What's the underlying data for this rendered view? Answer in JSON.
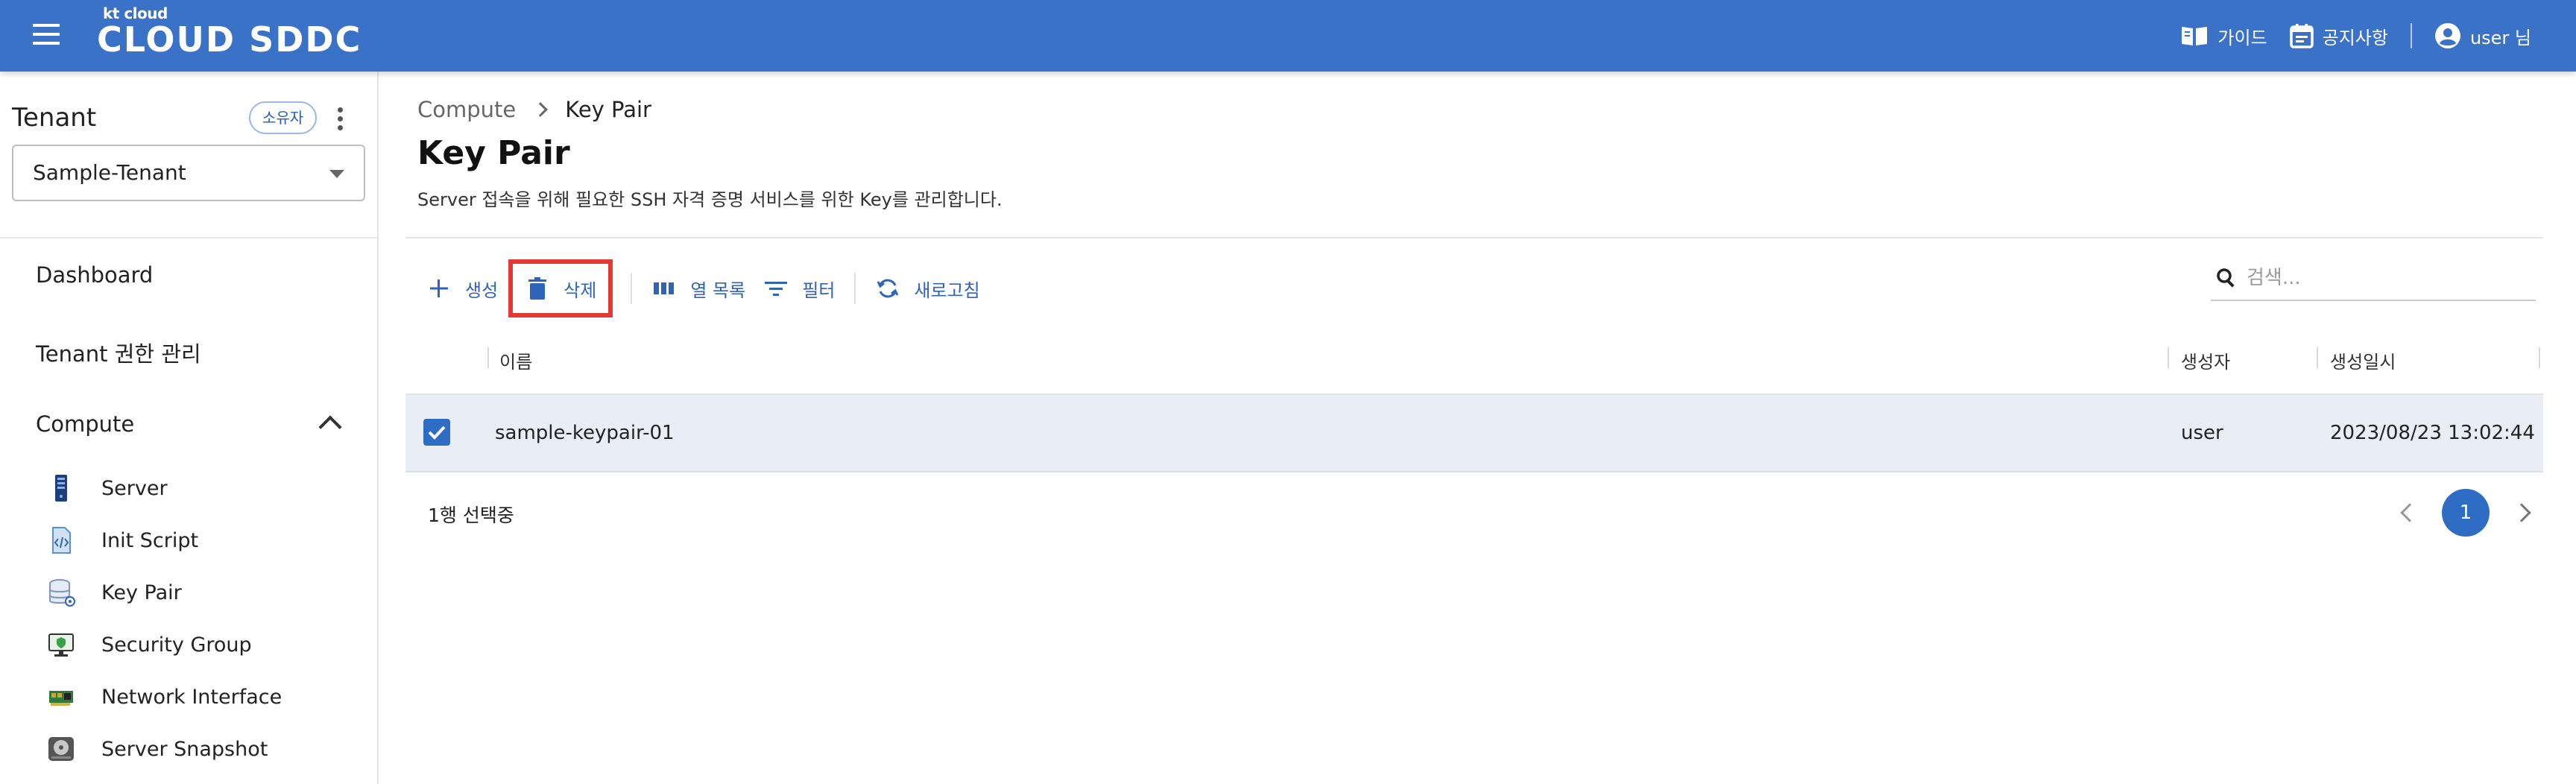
{
  "header": {
    "brand_small": "kt cloud",
    "brand_big": "CLOUD SDDC",
    "guide_label": "가이드",
    "notice_label": "공지사항",
    "user_label": "user 님",
    "bar_color": "#3a72c8"
  },
  "sidebar": {
    "tenant_title": "Tenant",
    "owner_badge": "소유자",
    "tenant_selected": "Sample-Tenant",
    "nav": {
      "dashboard": "Dashboard",
      "tenant_perm": "Tenant 권한 관리",
      "compute": "Compute"
    },
    "compute_items": [
      {
        "label": "Server",
        "icon": "server-icon"
      },
      {
        "label": "Init Script",
        "icon": "code-file-icon"
      },
      {
        "label": "Key Pair",
        "icon": "database-key-icon"
      },
      {
        "label": "Security Group",
        "icon": "monitor-shield-icon"
      },
      {
        "label": "Network Interface",
        "icon": "network-card-icon"
      },
      {
        "label": "Server Snapshot",
        "icon": "disk-snapshot-icon"
      }
    ]
  },
  "main": {
    "breadcrumb": {
      "parent": "Compute",
      "current": "Key Pair"
    },
    "title": "Key Pair",
    "description": "Server 접속을 위해 필요한 SSH 자격 증명 서비스를 위한 Key를 관리합니다.",
    "toolbar": {
      "create": "생성",
      "delete": "삭제",
      "columns": "열 목록",
      "filter": "필터",
      "refresh": "새로고침"
    },
    "search_placeholder": "검색...",
    "table": {
      "columns": [
        "이름",
        "생성자",
        "생성일시"
      ],
      "rows": [
        {
          "name": "sample-keypair-01",
          "creator": "user",
          "created_at": "2023/08/23 13:02:44",
          "selected": true
        }
      ],
      "selection_text": "1행 선택중",
      "current_page": "1"
    },
    "highlight_color": "#e53935",
    "accent_color": "#2f64b8"
  }
}
